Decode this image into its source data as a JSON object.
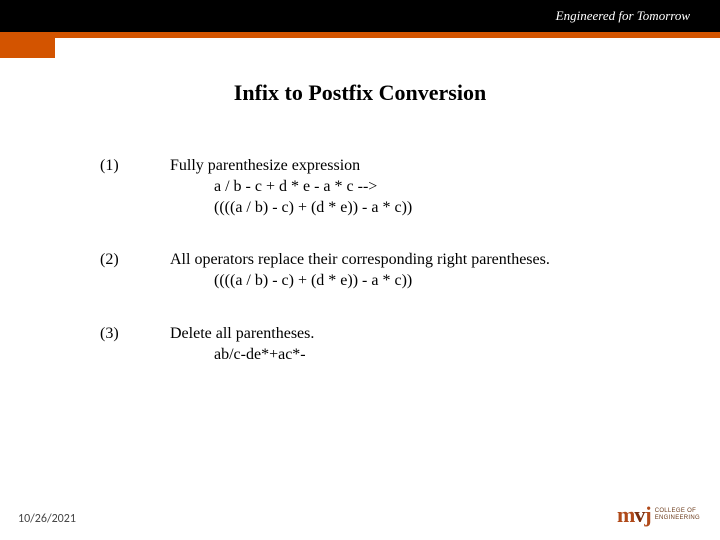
{
  "header": {
    "tagline": "Engineered for Tomorrow"
  },
  "title": "Infix to Postfix Conversion",
  "steps": [
    {
      "num": "(1)",
      "line1": "Fully parenthesize expression",
      "line2": "a / b - c + d * e - a * c -->",
      "line3": "((((a / b) - c) + (d * e)) - a * c))"
    },
    {
      "num": "(2)",
      "line1": "All operators replace their corresponding right parentheses.",
      "line2": "((((a / b) - c) + (d * e)) - a * c))",
      "line3": ""
    },
    {
      "num": "(3)",
      "line1": "Delete all parentheses.",
      "line2": "ab/c-de*+ac*-",
      "line3": ""
    }
  ],
  "footer": {
    "date": "10/26/2021",
    "logo_mark": "mvj",
    "logo_text1": "COLLEGE OF",
    "logo_text2": "ENGINEERING"
  }
}
